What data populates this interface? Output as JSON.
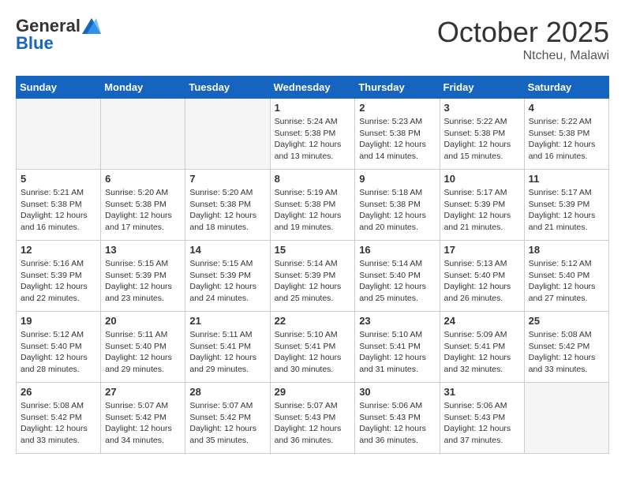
{
  "logo": {
    "general": "General",
    "blue": "Blue"
  },
  "header": {
    "month": "October 2025",
    "location": "Ntcheu, Malawi"
  },
  "weekdays": [
    "Sunday",
    "Monday",
    "Tuesday",
    "Wednesday",
    "Thursday",
    "Friday",
    "Saturday"
  ],
  "weeks": [
    [
      {
        "day": null,
        "info": null
      },
      {
        "day": null,
        "info": null
      },
      {
        "day": null,
        "info": null
      },
      {
        "day": "1",
        "info": "Sunrise: 5:24 AM\nSunset: 5:38 PM\nDaylight: 12 hours\nand 13 minutes."
      },
      {
        "day": "2",
        "info": "Sunrise: 5:23 AM\nSunset: 5:38 PM\nDaylight: 12 hours\nand 14 minutes."
      },
      {
        "day": "3",
        "info": "Sunrise: 5:22 AM\nSunset: 5:38 PM\nDaylight: 12 hours\nand 15 minutes."
      },
      {
        "day": "4",
        "info": "Sunrise: 5:22 AM\nSunset: 5:38 PM\nDaylight: 12 hours\nand 16 minutes."
      }
    ],
    [
      {
        "day": "5",
        "info": "Sunrise: 5:21 AM\nSunset: 5:38 PM\nDaylight: 12 hours\nand 16 minutes."
      },
      {
        "day": "6",
        "info": "Sunrise: 5:20 AM\nSunset: 5:38 PM\nDaylight: 12 hours\nand 17 minutes."
      },
      {
        "day": "7",
        "info": "Sunrise: 5:20 AM\nSunset: 5:38 PM\nDaylight: 12 hours\nand 18 minutes."
      },
      {
        "day": "8",
        "info": "Sunrise: 5:19 AM\nSunset: 5:38 PM\nDaylight: 12 hours\nand 19 minutes."
      },
      {
        "day": "9",
        "info": "Sunrise: 5:18 AM\nSunset: 5:38 PM\nDaylight: 12 hours\nand 20 minutes."
      },
      {
        "day": "10",
        "info": "Sunrise: 5:17 AM\nSunset: 5:39 PM\nDaylight: 12 hours\nand 21 minutes."
      },
      {
        "day": "11",
        "info": "Sunrise: 5:17 AM\nSunset: 5:39 PM\nDaylight: 12 hours\nand 21 minutes."
      }
    ],
    [
      {
        "day": "12",
        "info": "Sunrise: 5:16 AM\nSunset: 5:39 PM\nDaylight: 12 hours\nand 22 minutes."
      },
      {
        "day": "13",
        "info": "Sunrise: 5:15 AM\nSunset: 5:39 PM\nDaylight: 12 hours\nand 23 minutes."
      },
      {
        "day": "14",
        "info": "Sunrise: 5:15 AM\nSunset: 5:39 PM\nDaylight: 12 hours\nand 24 minutes."
      },
      {
        "day": "15",
        "info": "Sunrise: 5:14 AM\nSunset: 5:39 PM\nDaylight: 12 hours\nand 25 minutes."
      },
      {
        "day": "16",
        "info": "Sunrise: 5:14 AM\nSunset: 5:40 PM\nDaylight: 12 hours\nand 25 minutes."
      },
      {
        "day": "17",
        "info": "Sunrise: 5:13 AM\nSunset: 5:40 PM\nDaylight: 12 hours\nand 26 minutes."
      },
      {
        "day": "18",
        "info": "Sunrise: 5:12 AM\nSunset: 5:40 PM\nDaylight: 12 hours\nand 27 minutes."
      }
    ],
    [
      {
        "day": "19",
        "info": "Sunrise: 5:12 AM\nSunset: 5:40 PM\nDaylight: 12 hours\nand 28 minutes."
      },
      {
        "day": "20",
        "info": "Sunrise: 5:11 AM\nSunset: 5:40 PM\nDaylight: 12 hours\nand 29 minutes."
      },
      {
        "day": "21",
        "info": "Sunrise: 5:11 AM\nSunset: 5:41 PM\nDaylight: 12 hours\nand 29 minutes."
      },
      {
        "day": "22",
        "info": "Sunrise: 5:10 AM\nSunset: 5:41 PM\nDaylight: 12 hours\nand 30 minutes."
      },
      {
        "day": "23",
        "info": "Sunrise: 5:10 AM\nSunset: 5:41 PM\nDaylight: 12 hours\nand 31 minutes."
      },
      {
        "day": "24",
        "info": "Sunrise: 5:09 AM\nSunset: 5:41 PM\nDaylight: 12 hours\nand 32 minutes."
      },
      {
        "day": "25",
        "info": "Sunrise: 5:08 AM\nSunset: 5:42 PM\nDaylight: 12 hours\nand 33 minutes."
      }
    ],
    [
      {
        "day": "26",
        "info": "Sunrise: 5:08 AM\nSunset: 5:42 PM\nDaylight: 12 hours\nand 33 minutes."
      },
      {
        "day": "27",
        "info": "Sunrise: 5:07 AM\nSunset: 5:42 PM\nDaylight: 12 hours\nand 34 minutes."
      },
      {
        "day": "28",
        "info": "Sunrise: 5:07 AM\nSunset: 5:42 PM\nDaylight: 12 hours\nand 35 minutes."
      },
      {
        "day": "29",
        "info": "Sunrise: 5:07 AM\nSunset: 5:43 PM\nDaylight: 12 hours\nand 36 minutes."
      },
      {
        "day": "30",
        "info": "Sunrise: 5:06 AM\nSunset: 5:43 PM\nDaylight: 12 hours\nand 36 minutes."
      },
      {
        "day": "31",
        "info": "Sunrise: 5:06 AM\nSunset: 5:43 PM\nDaylight: 12 hours\nand 37 minutes."
      },
      {
        "day": null,
        "info": null
      }
    ]
  ]
}
